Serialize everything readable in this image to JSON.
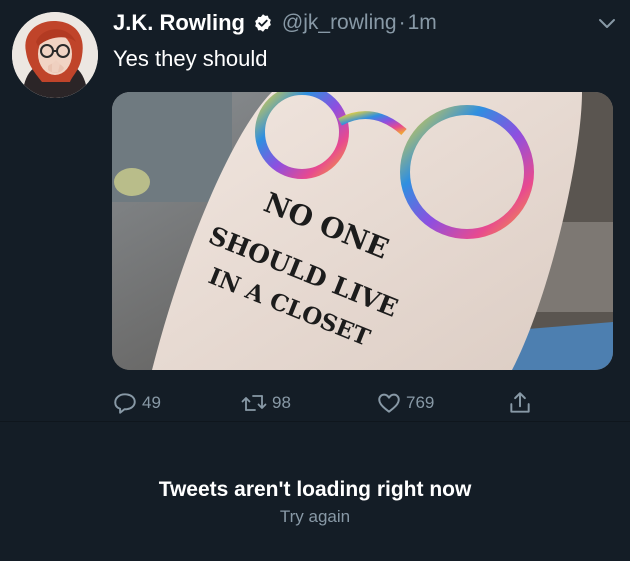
{
  "tweet": {
    "author_name": "J.K. Rowling",
    "handle": "@jk_rowling",
    "separator": "·",
    "time": "1m",
    "text": "Yes they should",
    "media": {
      "tattoo_lines": [
        "NO ONE",
        "SHOULD LIVE",
        "IN A CLOSET"
      ]
    },
    "actions": {
      "reply_count": "49",
      "retweet_count": "98",
      "like_count": "769"
    }
  },
  "status": {
    "message": "Tweets aren't loading right now",
    "retry_label": "Try again"
  },
  "colors": {
    "background": "#141d26",
    "primary_text": "#ffffff",
    "secondary_text": "#8899a6",
    "verified": "#ffffff"
  }
}
